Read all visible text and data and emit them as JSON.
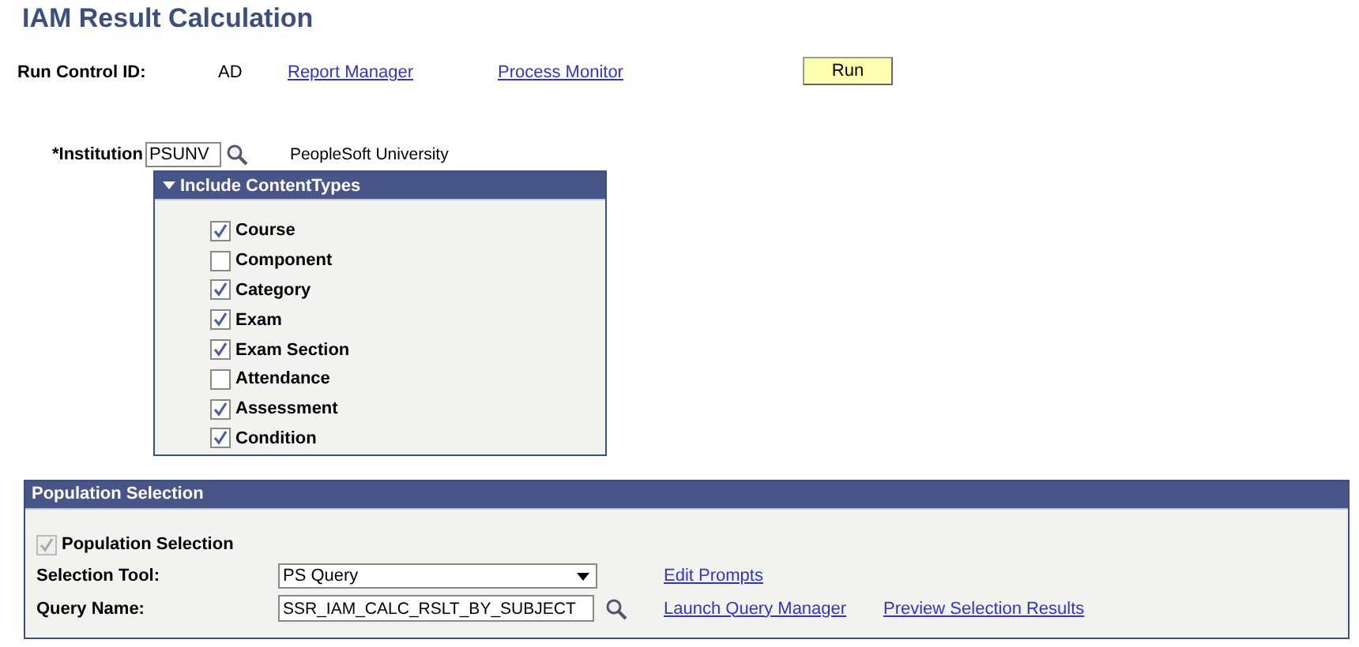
{
  "page_title": "IAM Result Calculation",
  "run_control": {
    "label": "Run Control ID:",
    "value": "AD",
    "links": [
      "Report Manager",
      "Process Monitor"
    ],
    "run_button": "Run"
  },
  "institution": {
    "label": "*Institution",
    "value": "PSUNV",
    "description": "PeopleSoft University"
  },
  "content_types": {
    "title": "Include ContentTypes",
    "expanded": true,
    "items": [
      {
        "label": "Course",
        "checked": true
      },
      {
        "label": "Component",
        "checked": false
      },
      {
        "label": "Category",
        "checked": true
      },
      {
        "label": "Exam",
        "checked": true
      },
      {
        "label": "Exam Section",
        "checked": true
      },
      {
        "label": "Attendance",
        "checked": false
      },
      {
        "label": "Assessment",
        "checked": true
      },
      {
        "label": "Condition",
        "checked": true
      }
    ]
  },
  "population_selection": {
    "title": "Population Selection",
    "checkbox": {
      "label": "Population Selection",
      "checked": true,
      "disabled": true
    },
    "selection_tool": {
      "label": "Selection Tool:",
      "value": "PS Query"
    },
    "query_name": {
      "label": "Query Name:",
      "value": "SSR_IAM_CALC_RSLT_BY_SUBJECT"
    },
    "links": [
      "Edit Prompts",
      "Launch Query Manager",
      "Preview Selection Results"
    ]
  }
}
